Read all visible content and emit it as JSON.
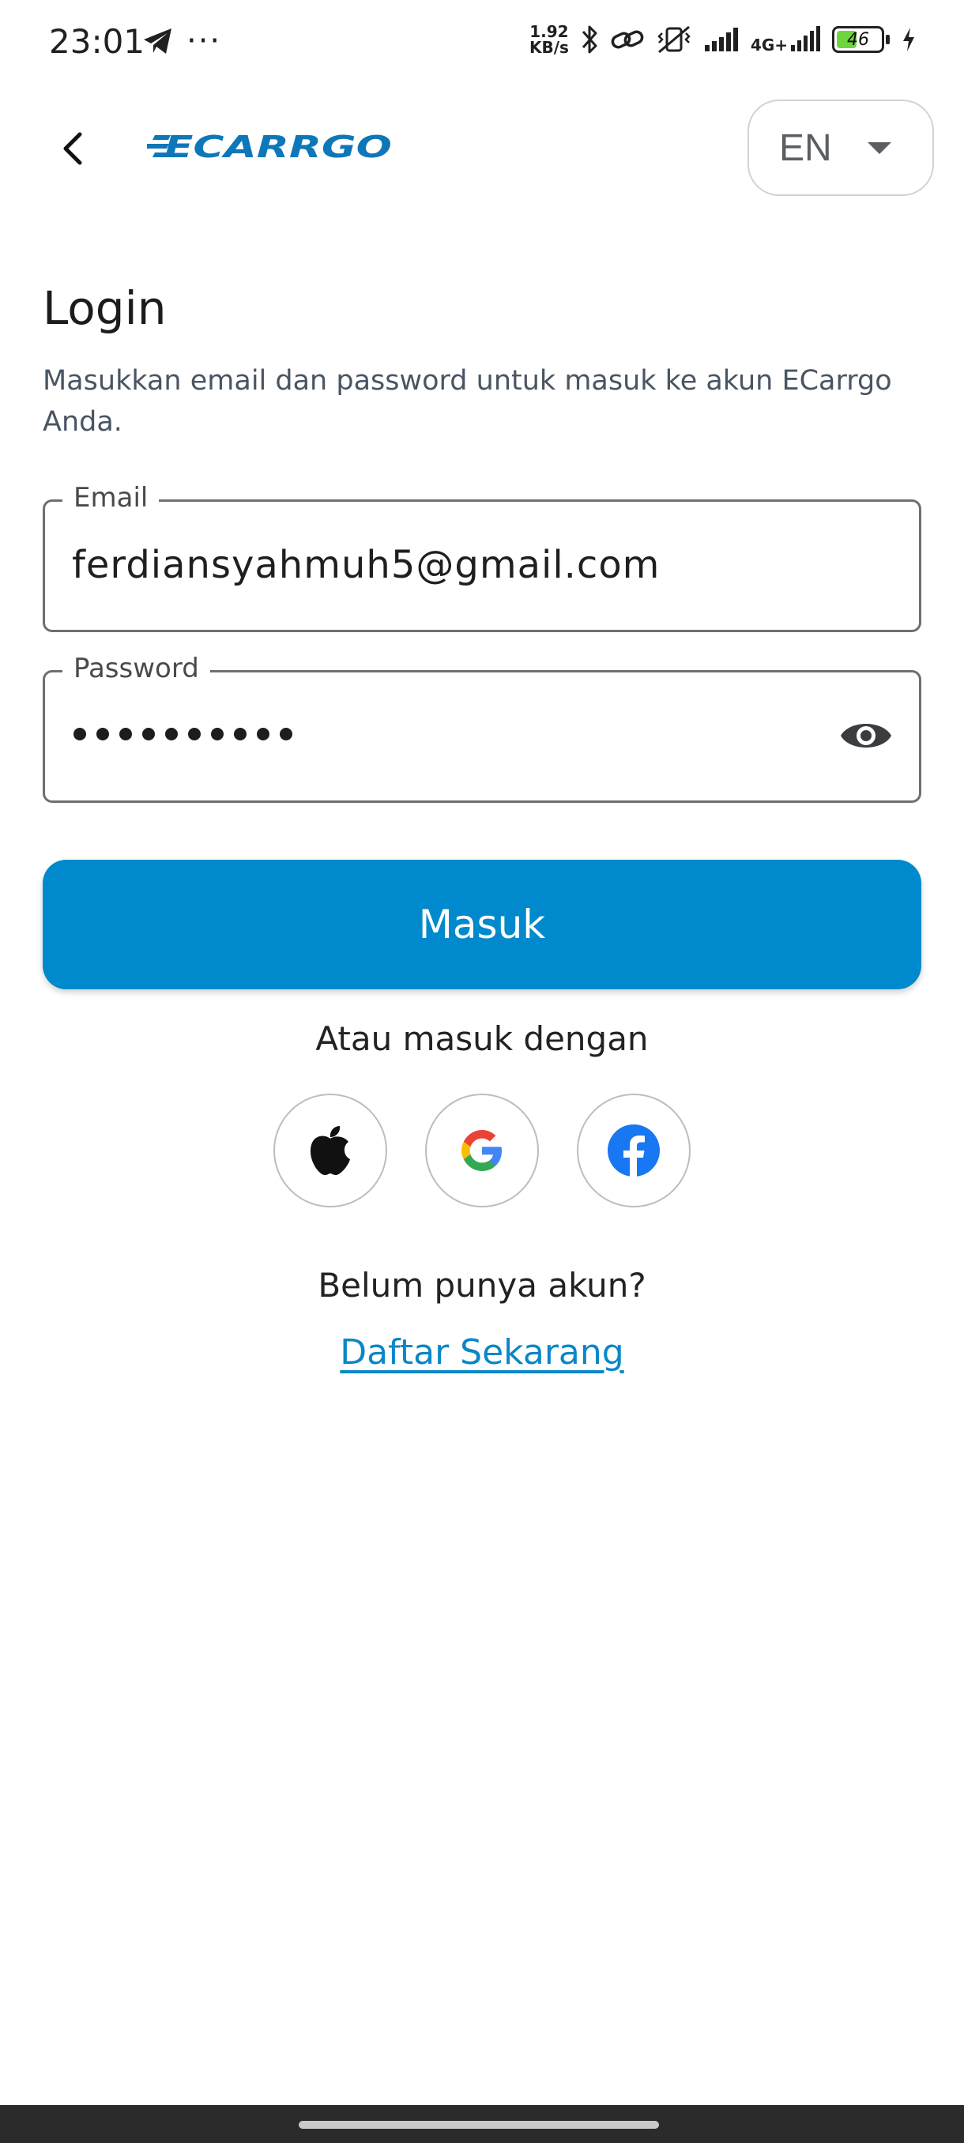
{
  "status_bar": {
    "time": "23:01",
    "network_speed_value": "1.92",
    "network_speed_unit": "KB/s",
    "signal_label": "4G+",
    "battery_percent": "46",
    "battery_level": 0.46
  },
  "header": {
    "logo_text": "ECARRGO",
    "language": "EN"
  },
  "login": {
    "title": "Login",
    "subtitle": "Masukkan email dan password untuk masuk ke akun ECarrgo Anda.",
    "email_label": "Email",
    "email_value": "ferdiansyahmuh5@gmail.com",
    "password_label": "Password",
    "password_length": 10,
    "submit_label": "Masuk",
    "alt_login_text": "Atau masuk dengan",
    "no_account_text": "Belum punya akun?",
    "register_link": "Daftar Sekarang"
  },
  "colors": {
    "primary": "#0089cc",
    "link": "#0a87c8",
    "logo": "#0e77b8"
  },
  "icons": {
    "social": [
      "apple-icon",
      "google-icon",
      "facebook-icon"
    ]
  }
}
